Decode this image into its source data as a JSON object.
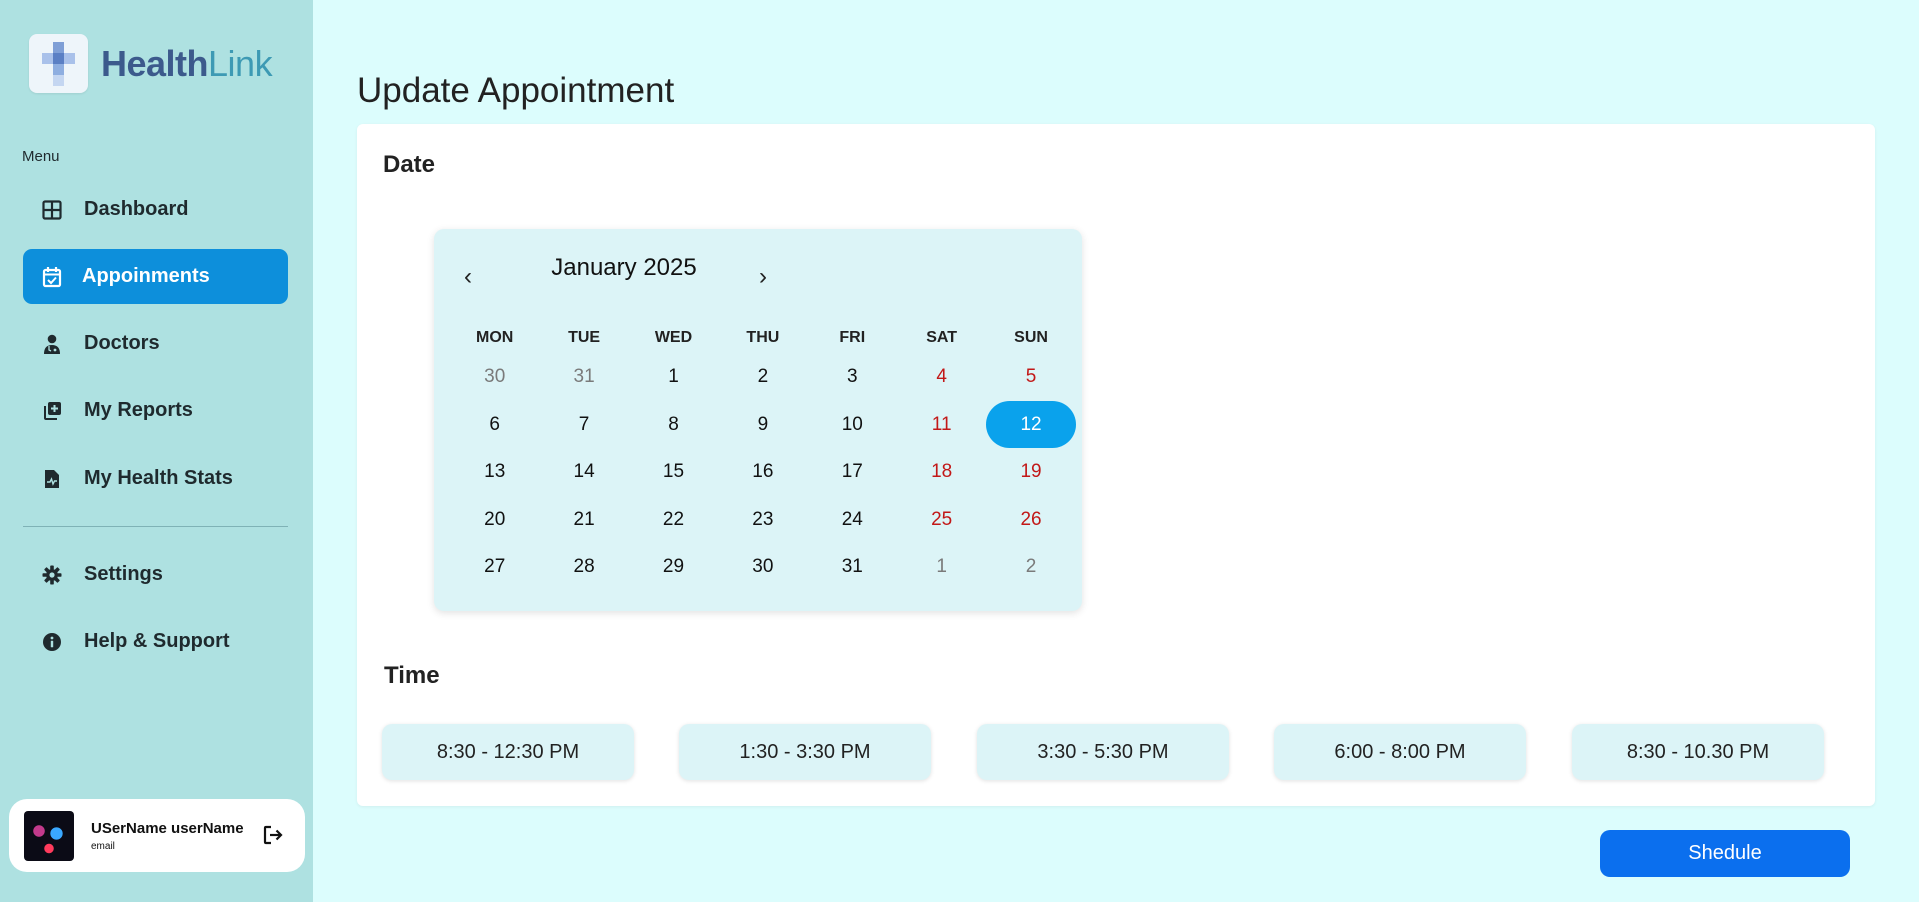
{
  "app": {
    "logo": {
      "part1": "Health",
      "part2": "Link"
    },
    "brand_colors": {
      "primary": "#0d8fdb",
      "sidebar_bg": "#aee1e1",
      "page_bg": "#dcfdfd"
    }
  },
  "sidebar": {
    "menu_label": "Menu",
    "items": [
      {
        "label": "Dashboard",
        "icon": "grid-icon",
        "active": false
      },
      {
        "label": "Appoinments",
        "icon": "calendar-check-icon",
        "active": true
      },
      {
        "label": "Doctors",
        "icon": "doctor-icon",
        "active": false
      },
      {
        "label": "My Reports",
        "icon": "add-copy-icon",
        "active": false
      },
      {
        "label": "My Health Stats",
        "icon": "file-pulse-icon",
        "active": false
      }
    ],
    "secondary_items": [
      {
        "label": "Settings",
        "icon": "gear-icon"
      },
      {
        "label": "Help & Support",
        "icon": "info-icon"
      }
    ],
    "user": {
      "name": "USerName userName",
      "email": "email"
    }
  },
  "main": {
    "title": "Update Appointment",
    "date_label": "Date",
    "time_label": "Time",
    "calendar": {
      "month_label": "January 2025",
      "prev": "‹",
      "next": "›",
      "weekdays": [
        "MON",
        "TUE",
        "WED",
        "THU",
        "FRI",
        "SAT",
        "SUN"
      ],
      "weeks": [
        [
          "30",
          "31",
          "1",
          "2",
          "3",
          "4",
          "5"
        ],
        [
          "6",
          "7",
          "8",
          "9",
          "10",
          "11",
          "12"
        ],
        [
          "13",
          "14",
          "15",
          "16",
          "17",
          "18",
          "19"
        ],
        [
          "20",
          "21",
          "22",
          "23",
          "24",
          "25",
          "26"
        ],
        [
          "27",
          "28",
          "29",
          "30",
          "31",
          "1",
          "2"
        ]
      ],
      "selected_day": "12"
    },
    "time_slots": [
      "8:30 - 12:30 PM",
      "1:30 - 3:30 PM",
      "3:30 - 5:30 PM",
      "6:00 - 8:00 PM",
      "8:30 - 10.30 PM"
    ],
    "schedule_label": "Shedule"
  }
}
